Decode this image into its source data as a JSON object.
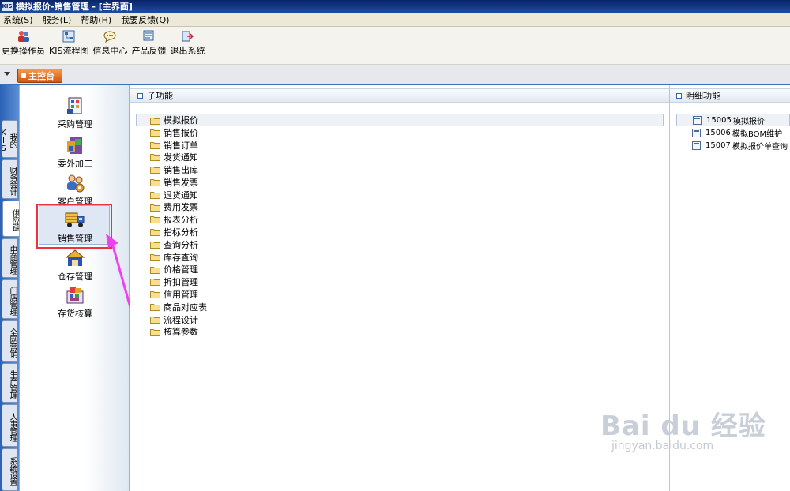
{
  "window": {
    "logo_text": "KIS",
    "title": "模拟报价-销售管理 - [主界面]"
  },
  "menubar": [
    {
      "label": "系统(S)"
    },
    {
      "label": "服务(L)"
    },
    {
      "label": "帮助(H)"
    },
    {
      "label": "我要反馈(Q)"
    }
  ],
  "toolbar": [
    {
      "label": "更换操作员",
      "icon": "change-operator-icon"
    },
    {
      "label": "KIS流程图",
      "icon": "flowchart-icon"
    },
    {
      "label": "信息中心",
      "icon": "message-center-icon"
    },
    {
      "label": "产品反馈",
      "icon": "feedback-icon"
    },
    {
      "label": "退出系统",
      "icon": "exit-icon"
    }
  ],
  "main_tab": {
    "label": "主控台"
  },
  "vtabs": [
    {
      "label": "我的KIS"
    },
    {
      "label": "财务会计"
    },
    {
      "label": "供应链",
      "active": true
    },
    {
      "label": "电商管理"
    },
    {
      "label": "门店管理"
    },
    {
      "label": "全网营销"
    },
    {
      "label": "生产管理"
    },
    {
      "label": "人事管理"
    },
    {
      "label": "系统设置"
    }
  ],
  "nav_items": [
    {
      "label": "采购管理",
      "icon": "purchase-management-icon"
    },
    {
      "label": "委外加工",
      "icon": "outsourcing-icon"
    },
    {
      "label": "客户管理",
      "icon": "customer-management-icon"
    },
    {
      "label": "销售管理",
      "icon": "sales-truck-icon",
      "selected": true
    },
    {
      "label": "仓存管理",
      "icon": "warehouse-icon"
    },
    {
      "label": "存货核算",
      "icon": "inventory-accounting-icon"
    }
  ],
  "sub_panel": {
    "title": "子功能",
    "folders": [
      {
        "label": "模拟报价",
        "selected": true
      },
      {
        "label": "销售报价"
      },
      {
        "label": "销售订单"
      },
      {
        "label": "发货通知"
      },
      {
        "label": "销售出库"
      },
      {
        "label": "销售发票"
      },
      {
        "label": "退货通知"
      },
      {
        "label": "费用发票"
      },
      {
        "label": "报表分析"
      },
      {
        "label": "指标分析"
      },
      {
        "label": "查询分析"
      },
      {
        "label": "库存查询"
      },
      {
        "label": "价格管理"
      },
      {
        "label": "折扣管理"
      },
      {
        "label": "信用管理"
      },
      {
        "label": "商品对应表"
      },
      {
        "label": "流程设计"
      },
      {
        "label": "核算参数"
      }
    ]
  },
  "detail_panel": {
    "title": "明细功能",
    "items": [
      {
        "code": "15005",
        "name": "模拟报价",
        "selected": true
      },
      {
        "code": "15006",
        "name": "模拟BOM维护"
      },
      {
        "code": "15007",
        "name": "模拟报价单查询"
      }
    ]
  },
  "watermark": {
    "main": "Bai du 经验",
    "sub": "jingyan.baidu.com"
  },
  "colors": {
    "accent": "#3d6fb8",
    "tab_orange": "#e0651c",
    "highlight_red": "#e8343c",
    "arrow_magenta": "#ee3ff0"
  }
}
